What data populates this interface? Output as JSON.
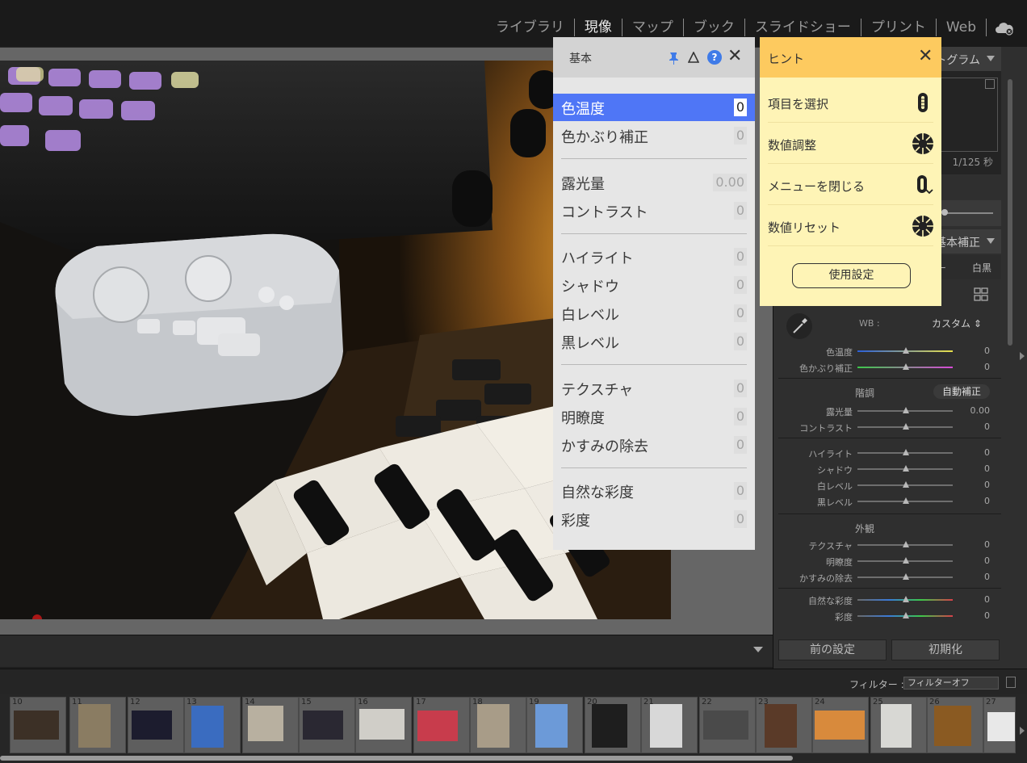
{
  "modules": [
    {
      "label": "ライブラリ",
      "active": false
    },
    {
      "label": "現像",
      "active": true
    },
    {
      "label": "マップ",
      "active": false
    },
    {
      "label": "ブック",
      "active": false
    },
    {
      "label": "スライドショー",
      "active": false
    },
    {
      "label": "プリント",
      "active": false
    },
    {
      "label": "Web",
      "active": false
    }
  ],
  "right_panel": {
    "histogram_header": "ヒストグラム",
    "shutter": "1/125 秒",
    "basic_header": "基本補正",
    "treatment_bw": "白黒",
    "wb_label": "WB :",
    "wb_value": "カスタム ⇕",
    "tone_label": "階調",
    "auto_label": "自動補正",
    "presence_label": "外観",
    "sliders": [
      {
        "label": "色温度",
        "value": "0"
      },
      {
        "label": "色かぶり補正",
        "value": "0"
      },
      {
        "label": "露光量",
        "value": "0.00"
      },
      {
        "label": "コントラスト",
        "value": "0"
      },
      {
        "label": "ハイライト",
        "value": "0"
      },
      {
        "label": "シャドウ",
        "value": "0"
      },
      {
        "label": "白レベル",
        "value": "0"
      },
      {
        "label": "黒レベル",
        "value": "0"
      },
      {
        "label": "テクスチャ",
        "value": "0"
      },
      {
        "label": "明瞭度",
        "value": "0"
      },
      {
        "label": "かすみの除去",
        "value": "0"
      },
      {
        "label": "自然な彩度",
        "value": "0"
      },
      {
        "label": "彩度",
        "value": "0"
      }
    ],
    "prev_button": "前の設定",
    "reset_button": "初期化"
  },
  "filter": {
    "label": "フィルター :",
    "value": "フィルターオフ"
  },
  "filmstrip": {
    "numbers": [
      "10",
      "11",
      "12",
      "13",
      "14",
      "15",
      "16",
      "17",
      "18",
      "19",
      "20",
      "21",
      "22",
      "23",
      "24",
      "25",
      "26",
      "27"
    ]
  },
  "basic_panel": {
    "title": "基本",
    "help_glyph": "?",
    "close_glyph": "✕",
    "items": [
      {
        "label": "色温度",
        "value": "0",
        "selected": true
      },
      {
        "label": "色かぶり補正",
        "value": "0"
      },
      {
        "label": "露光量",
        "value": "0.00"
      },
      {
        "label": "コントラスト",
        "value": "0"
      },
      {
        "label": "ハイライト",
        "value": "0"
      },
      {
        "label": "シャドウ",
        "value": "0"
      },
      {
        "label": "白レベル",
        "value": "0"
      },
      {
        "label": "黒レベル",
        "value": "0"
      },
      {
        "label": "テクスチャ",
        "value": "0"
      },
      {
        "label": "明瞭度",
        "value": "0"
      },
      {
        "label": "かすみの除去",
        "value": "0"
      },
      {
        "label": "自然な彩度",
        "value": "0"
      },
      {
        "label": "彩度",
        "value": "0"
      }
    ]
  },
  "hint_panel": {
    "title": "ヒント",
    "close_glyph": "✕",
    "items": [
      {
        "label": "項目を選択",
        "icon": "scroll-wheel-icon"
      },
      {
        "label": "数値調整",
        "icon": "dial-icon"
      },
      {
        "label": "メニューを閉じる",
        "icon": "wheel-press-icon"
      },
      {
        "label": "数値リセット",
        "icon": "dial-press-icon"
      }
    ],
    "settings_button": "使用設定"
  },
  "colors": {
    "selected_row": "#4f76f6",
    "hint_header": "#fdca5f",
    "hint_body": "#fef4b6",
    "help_icon": "#3f7be8"
  }
}
